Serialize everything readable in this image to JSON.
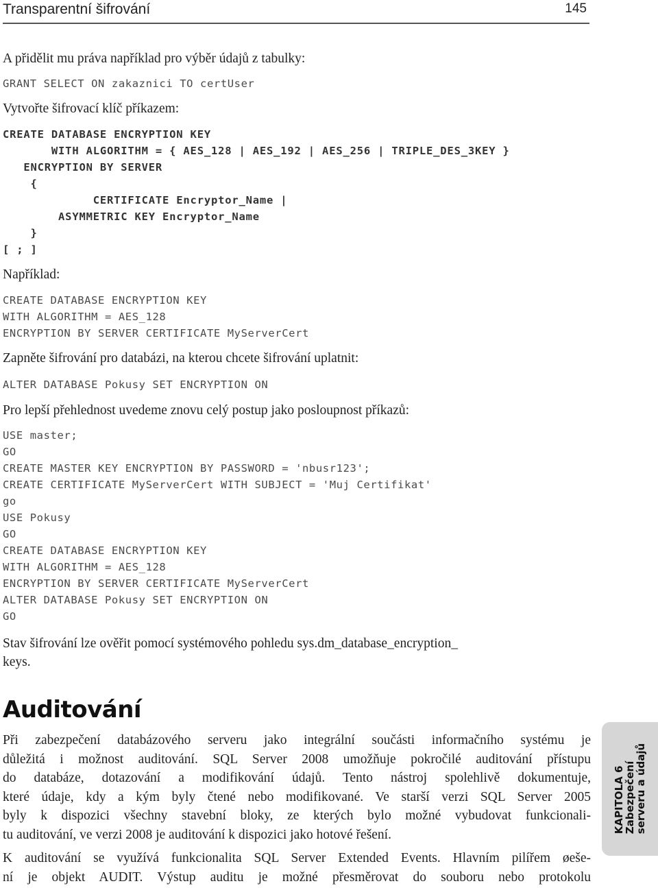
{
  "header": {
    "title": "Transparentní šifrování",
    "page_number": "145"
  },
  "blocks": {
    "intro_grant": "A přidělit mu práva například pro výběr údajů z tabulky:",
    "grant_code": "GRANT SELECT ON zakaznici TO certUser",
    "create_key_intro": "Vytvořte šifrovací klíč příkazem:",
    "syntax_code": [
      "CREATE DATABASE ENCRYPTION KEY",
      "       WITH ALGORITHM = { AES_128 | AES_192 | AES_256 | TRIPLE_DES_3KEY }",
      "   ENCRYPTION BY SERVER",
      "    {",
      "             CERTIFICATE Encryptor_Name |",
      "        ASYMMETRIC KEY Encryptor_Name",
      "    }",
      "[ ; ]"
    ],
    "example_label": "Například:",
    "example_code": [
      "CREATE DATABASE ENCRYPTION KEY",
      "WITH ALGORITHM = AES_128",
      "ENCRYPTION BY SERVER CERTIFICATE MyServerCert"
    ],
    "enable_intro": "Zapněte šifrování pro databázi, na kterou chcete šifrování uplatnit:",
    "enable_code": "ALTER DATABASE Pokusy SET ENCRYPTION ON",
    "sequence_intro": "Pro lepší přehlednost uvedeme znovu celý postup jako posloupnost příkazů:",
    "sequence_code": [
      "USE master;",
      "GO",
      "CREATE MASTER KEY ENCRYPTION BY PASSWORD = 'nbusr123';",
      "CREATE CERTIFICATE MyServerCert WITH SUBJECT = 'Muj Certifikat'",
      "go",
      "USE Pokusy",
      "GO",
      "CREATE DATABASE ENCRYPTION KEY",
      "WITH ALGORITHM = AES_128",
      "ENCRYPTION BY SERVER CERTIFICATE MyServerCert",
      "ALTER DATABASE Pokusy SET ENCRYPTION ON",
      "GO"
    ],
    "status_lines": [
      "Stav šifrování lze ověřit pomocí systémového pohledu sys.dm_database_encryption_",
      "keys."
    ]
  },
  "section": {
    "heading": "Auditování",
    "paragraph1_lines": [
      "Při zabezpečení databázového serveru jako integrální součásti informačního systému je",
      "důležitá i možnost auditování. SQL Server 2008 umožňuje pokročilé auditování přístupu",
      "do databáze, dotazování a modifikování údajů. Tento nástroj spolehlivě dokumentuje,",
      "které údaje, kdy a kým byly čtené nebo modifikované. Ve starší verzi SQL Server 2005",
      "byly k dispozici všechny stavební bloky, ze kterých bylo možné vybudovat funkcionali-",
      "tu auditování, ve verzi 2008 je auditování k dispozici jako hotové řešení."
    ],
    "paragraph2_lines": [
      "K auditování se využívá funkcionalita SQL Server Extended Events. Hlavním pilířem øeše-",
      "ní je objekt AUDIT. Výstup auditu je možné přesměrovat do souboru nebo protokolu"
    ]
  },
  "side_tab": {
    "chapter": "KAPITOLA 6",
    "line2": "Zabezpečení",
    "line3": "serveru a údajů"
  }
}
